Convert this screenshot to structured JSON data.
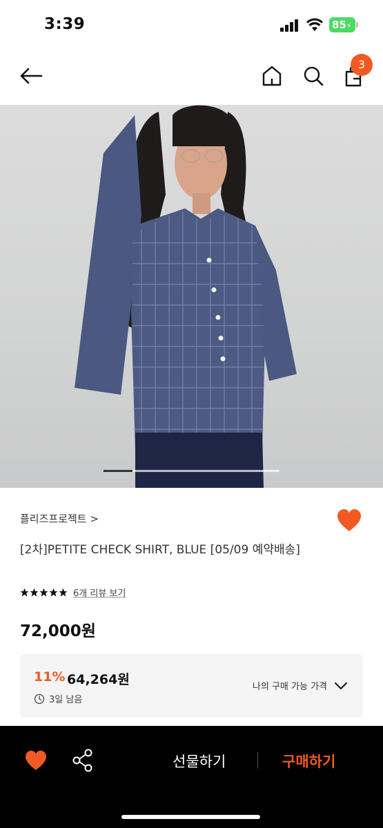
{
  "status_bar": {
    "time": "3:39",
    "battery": "85"
  },
  "header": {
    "cart_count": "3",
    "icons": [
      "back-arrow-icon",
      "home-icon",
      "search-icon",
      "shopping-bag-icon"
    ]
  },
  "product": {
    "brand": "플리즈프로젝트 >",
    "title": "[2차]PETITE CHECK SHIRT, BLUE [05/09 예약배송]",
    "rating": 5,
    "review_link": "6개 리뷰 보기",
    "price": "72,000원",
    "image_alt": "product-photo"
  },
  "carousel": {
    "current": 1
  },
  "coupon": {
    "discount_rate": "11%",
    "discount_price": "64,264원",
    "time_left": "3일 남음",
    "my_price_label": "나의 구매 가능 가격"
  },
  "bottom_bar": {
    "gift_label": "선물하기",
    "buy_label": "구매하기"
  },
  "colors": {
    "accent": "#f15a22",
    "bar_bg": "#000000"
  }
}
